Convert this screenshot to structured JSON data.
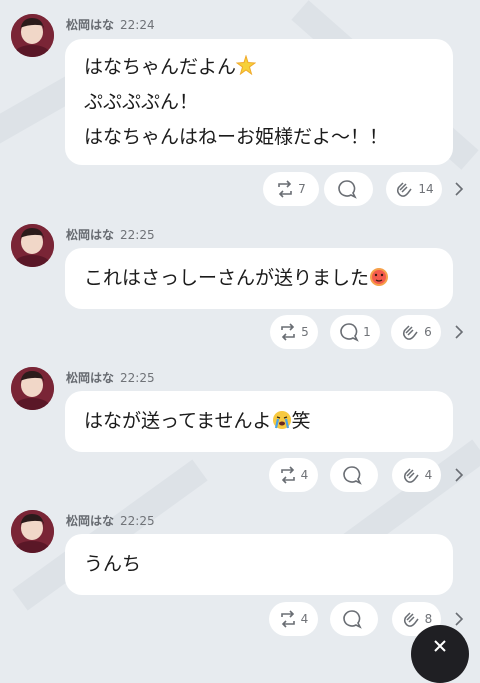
{
  "messages": [
    {
      "author": "松岡はな",
      "time": "22:24",
      "lines": [
        "はなちゃんだよん",
        "ぷぷぷぷん！",
        "はなちゃんはねーお姫様だよ〜！！"
      ],
      "reposts": "7",
      "replies": "",
      "claps": "14"
    },
    {
      "author": "松岡はな",
      "time": "22:25",
      "lines": [
        "これはさっしーさんが送りました"
      ],
      "reposts": "5",
      "replies": "1",
      "claps": "6"
    },
    {
      "author": "松岡はな",
      "time": "22:25",
      "lines": [
        "はなが送ってませんよ",
        "笑"
      ],
      "reposts": "4",
      "replies": "",
      "claps": "4"
    },
    {
      "author": "松岡はな",
      "time": "22:25",
      "lines": [
        "うんち"
      ],
      "reposts": "4",
      "replies": "",
      "claps": "8"
    }
  ],
  "icons": {
    "repost": "repost-icon",
    "reply": "speech-bubble-icon",
    "clap": "clap-hands-icon",
    "more": "chevron-right-icon",
    "close": "close-icon",
    "sparkle": "glowing-star-emoji",
    "blush": "blushing-face-emoji",
    "cry": "loudly-crying-face-emoji"
  },
  "colors": {
    "background": "#e7ebef",
    "bubble": "#ffffff",
    "meta_text": "#707378",
    "fab": "#1f1f23"
  }
}
